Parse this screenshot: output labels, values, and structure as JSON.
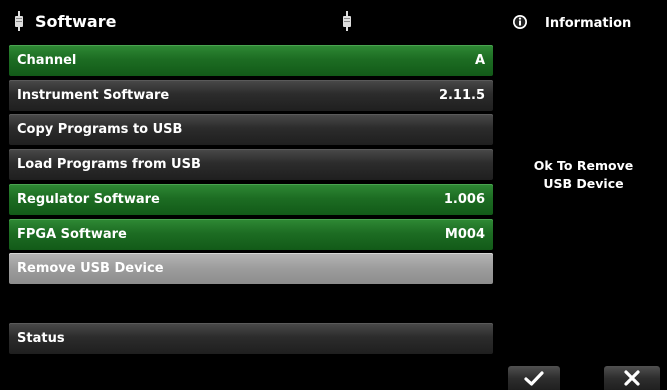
{
  "header": {
    "title": "Software"
  },
  "info": {
    "title": "Information",
    "message_line1": "Ok To Remove",
    "message_line2": "USB Device"
  },
  "rows": [
    {
      "label": "Channel",
      "value": "A"
    },
    {
      "label": "Instrument Software",
      "value": "2.11.5"
    },
    {
      "label": "Copy Programs to USB",
      "value": ""
    },
    {
      "label": "Load Programs from USB",
      "value": ""
    },
    {
      "label": "Regulator Software",
      "value": "1.006"
    },
    {
      "label": "FPGA Software",
      "value": "M004"
    },
    {
      "label": "Remove USB Device",
      "value": ""
    },
    {
      "label": "Status",
      "value": ""
    }
  ],
  "icons": {
    "usb": "usb-plug-icon",
    "info": "info-icon",
    "ok": "checkmark-icon",
    "cancel": "close-icon"
  },
  "colors": {
    "green_row": "#1d6d23",
    "dark_row": "#2c2c2c",
    "selected_row": "#9c9c9c",
    "background": "#000000"
  }
}
